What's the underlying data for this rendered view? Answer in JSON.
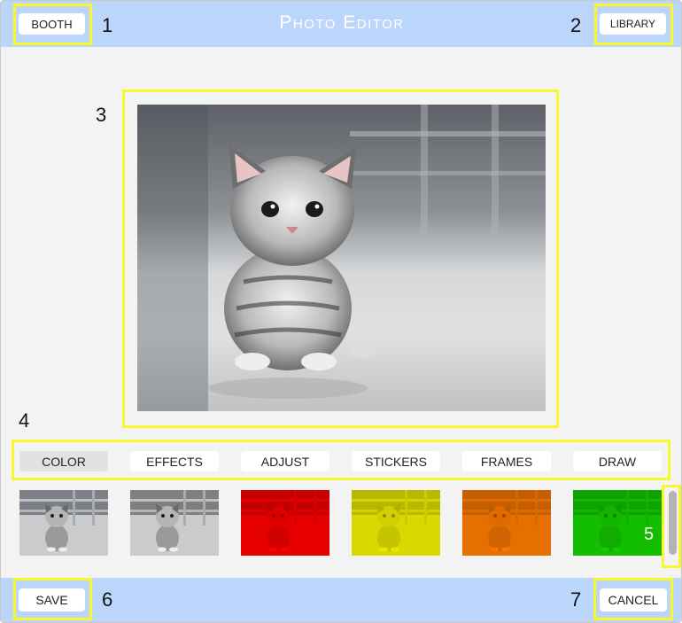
{
  "header": {
    "title": "Photo Editor",
    "booth_label": "BOOTH",
    "library_label": "LIBRARY"
  },
  "footer": {
    "save_label": "SAVE",
    "cancel_label": "CANCEL"
  },
  "annotations": {
    "n1": "1",
    "n2": "2",
    "n3": "3",
    "n4": "4",
    "n5": "5",
    "n6": "6",
    "n7": "7"
  },
  "tabs": [
    {
      "label": "COLOR",
      "active": true
    },
    {
      "label": "EFFECTS",
      "active": false
    },
    {
      "label": "ADJUST",
      "active": false
    },
    {
      "label": "STICKERS",
      "active": false
    },
    {
      "label": "FRAMES",
      "active": false
    },
    {
      "label": "DRAW",
      "active": false
    }
  ],
  "filters": [
    {
      "name": "original",
      "tint": "transparent"
    },
    {
      "name": "grayscale",
      "tint": "#9a9a9a"
    },
    {
      "name": "red",
      "tint": "#ff0000"
    },
    {
      "name": "yellow",
      "tint": "#f0ee00"
    },
    {
      "name": "orange",
      "tint": "#ff7a00"
    },
    {
      "name": "green",
      "tint": "#15d100"
    }
  ],
  "colors": {
    "bar": "#bcd6fb",
    "highlight": "#f7f72a",
    "background": "#f3f3f3"
  }
}
